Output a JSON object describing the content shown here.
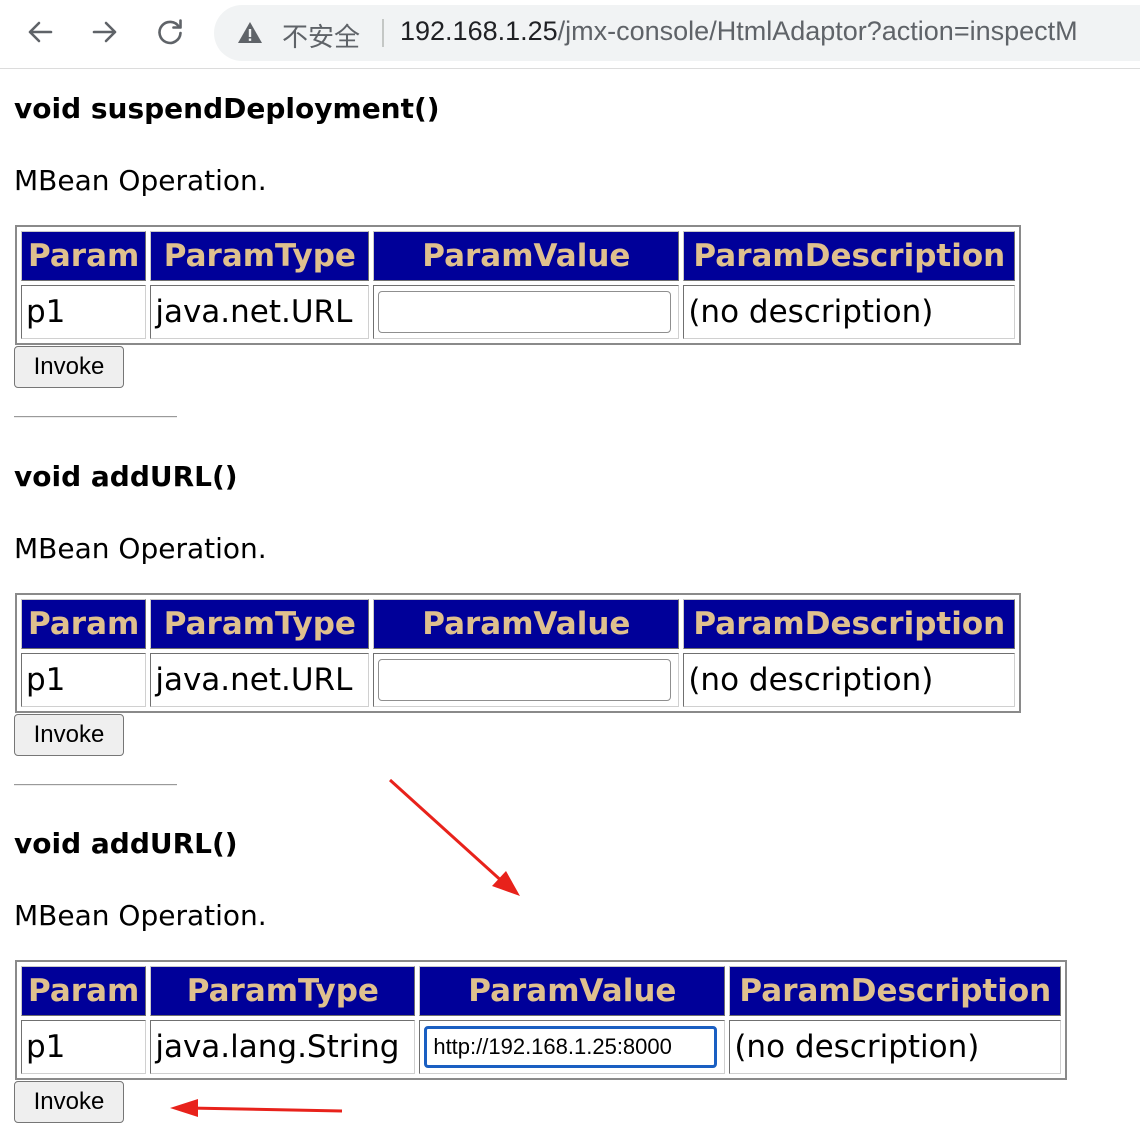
{
  "browser": {
    "security_label": "不安全",
    "url_host": "192.168.1.25",
    "url_path": "/jmx-console/HtmlAdaptor?action=inspectM"
  },
  "operations": [
    {
      "title": "void suspendDeployment()",
      "description": "MBean Operation.",
      "headers": [
        "Param",
        "ParamType",
        "ParamValue",
        "ParamDescription"
      ],
      "param": "p1",
      "param_type": "java.net.URL",
      "param_value": "",
      "param_description": "(no description)",
      "invoke_label": "Invoke"
    },
    {
      "title": "void addURL()",
      "description": "MBean Operation.",
      "headers": [
        "Param",
        "ParamType",
        "ParamValue",
        "ParamDescription"
      ],
      "param": "p1",
      "param_type": "java.net.URL",
      "param_value": "",
      "param_description": "(no description)",
      "invoke_label": "Invoke"
    },
    {
      "title": "void addURL()",
      "description": "MBean Operation.",
      "headers": [
        "Param",
        "ParamType",
        "ParamValue",
        "ParamDescription"
      ],
      "param": "p1",
      "param_type": "java.lang.String",
      "param_value": "http://192.168.1.25:8000",
      "param_description": "(no description)",
      "invoke_label": "Invoke"
    }
  ],
  "colors": {
    "header_bg": "#000099",
    "header_text": "#dfc08e",
    "annotation_arrow": "#e8221b",
    "focus_ring": "#1a5fc2"
  },
  "icons": [
    "back-arrow-icon",
    "forward-arrow-icon",
    "reload-icon",
    "warning-icon",
    "annotation-arrow-icon"
  ]
}
